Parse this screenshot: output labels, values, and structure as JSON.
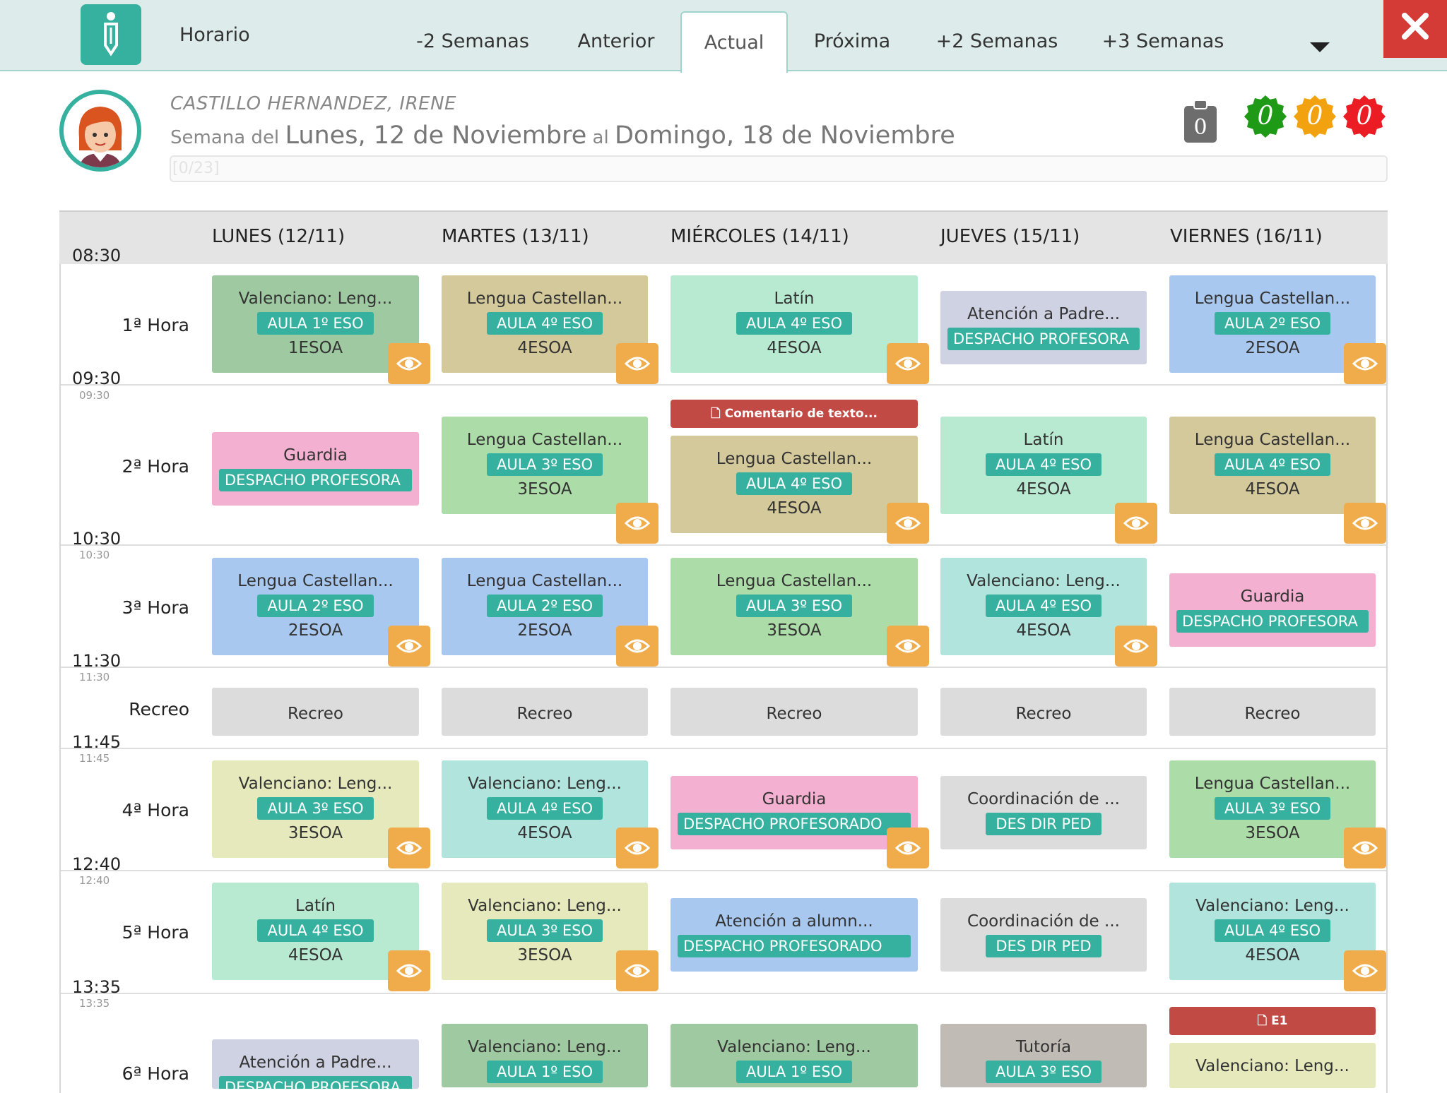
{
  "app": {
    "title": "Horario"
  },
  "tabs": [
    "-2 Semanas",
    "Anterior",
    "Actual",
    "Próxima",
    "+2 Semanas",
    "+3 Semanas"
  ],
  "header": {
    "teacher": "CASTILLO HERNANDEZ, IRENE",
    "week_prefix": "Semana del",
    "week_from": "Lunes, 12 de Noviembre",
    "week_mid": "al",
    "week_to": "Domingo, 18 de Noviembre",
    "progress_text": "[0/23]",
    "clipboard_count": "0",
    "counters": [
      {
        "value": "0",
        "color": "#1e9a16"
      },
      {
        "value": "0",
        "color": "#f2a20f"
      },
      {
        "value": "0",
        "color": "#ec1c24"
      }
    ]
  },
  "days": [
    "LUNES (12/11)",
    "MARTES (13/11)",
    "MIÉRCOLES (14/11)",
    "JUEVES (15/11)",
    "VIERNES (16/11)"
  ],
  "times": {
    "t0": "08:30",
    "t1": "09:30",
    "t1s": "09:30",
    "t2": "10:30",
    "t2s": "10:30",
    "t3": "11:30",
    "t3s": "11:30",
    "t4": "11:45",
    "t4s": "11:45",
    "t5": "12:40",
    "t5s": "12:40",
    "t6": "13:35",
    "t6s": "13:35"
  },
  "periods": [
    "1ª Hora",
    "2ª Hora",
    "3ª Hora",
    "Recreo",
    "4ª Hora",
    "5ª Hora",
    "6ª Hora"
  ],
  "cells": {
    "r1": [
      {
        "subject": "Valenciano: Leng...",
        "room": "AULA 1º ESO",
        "group": "1ESOA"
      },
      {
        "subject": "Lengua Castellan...",
        "room": "AULA 4º ESO",
        "group": "4ESOA"
      },
      {
        "subject": "Latín",
        "room": "AULA 4º ESO",
        "group": "4ESOA"
      },
      {
        "subject": "Atención a Padre...",
        "room": "DESPACHO PROFESORA"
      },
      {
        "subject": "Lengua Castellan...",
        "room": "AULA 2º ESO",
        "group": "2ESOA"
      }
    ],
    "r2": [
      {
        "subject": "Guardia",
        "room": "DESPACHO PROFESORA"
      },
      {
        "subject": "Lengua Castellan...",
        "room": "AULA 3º ESO",
        "group": "3ESOA"
      },
      {
        "subject": "Lengua Castellan...",
        "room": "AULA 4º ESO",
        "group": "4ESOA",
        "note": "Comentario de texto..."
      },
      {
        "subject": "Latín",
        "room": "AULA 4º ESO",
        "group": "4ESOA"
      },
      {
        "subject": "Lengua Castellan...",
        "room": "AULA 4º ESO",
        "group": "4ESOA"
      }
    ],
    "r3": [
      {
        "subject": "Lengua Castellan...",
        "room": "AULA 2º ESO",
        "group": "2ESOA"
      },
      {
        "subject": "Lengua Castellan...",
        "room": "AULA 2º ESO",
        "group": "2ESOA"
      },
      {
        "subject": "Lengua Castellan...",
        "room": "AULA 3º ESO",
        "group": "3ESOA"
      },
      {
        "subject": "Valenciano: Leng...",
        "room": "AULA 4º ESO",
        "group": "4ESOA"
      },
      {
        "subject": "Guardia",
        "room": "DESPACHO PROFESORA"
      }
    ],
    "recreo": [
      "Recreo",
      "Recreo",
      "Recreo",
      "Recreo",
      "Recreo"
    ],
    "r4": [
      {
        "subject": "Valenciano: Leng...",
        "room": "AULA 3º ESO",
        "group": "3ESOA"
      },
      {
        "subject": "Valenciano: Leng...",
        "room": "AULA 4º ESO",
        "group": "4ESOA"
      },
      {
        "subject": "Guardia",
        "room": "DESPACHO PROFESORADO"
      },
      {
        "subject": "Coordinación de ...",
        "room": "DES DIR PED"
      },
      {
        "subject": "Lengua Castellan...",
        "room": "AULA 3º ESO",
        "group": "3ESOA"
      }
    ],
    "r5": [
      {
        "subject": "Latín",
        "room": "AULA 4º ESO",
        "group": "4ESOA"
      },
      {
        "subject": "Valenciano: Leng...",
        "room": "AULA 3º ESO",
        "group": "3ESOA"
      },
      {
        "subject": "Atención a alumn...",
        "room": "DESPACHO PROFESORADO"
      },
      {
        "subject": "Coordinación de ...",
        "room": "DES DIR PED"
      },
      {
        "subject": "Valenciano: Leng...",
        "room": "AULA 4º ESO",
        "group": "4ESOA"
      }
    ],
    "r6": [
      {
        "subject": "Atención a Padre...",
        "room": "DESPACHO PROFESORA"
      },
      {
        "subject": "Valenciano: Leng...",
        "room": "AULA 1º ESO"
      },
      {
        "subject": "Valenciano: Leng...",
        "room": "AULA 1º ESO"
      },
      {
        "subject": "Tutoría",
        "room": "AULA 3º ESO"
      },
      {
        "subject": "Valenciano: Leng...",
        "note": "E1"
      }
    ]
  },
  "colors": {
    "green_dark": "#9fc9a0",
    "tan": "#d3c99b",
    "mint": "#b8ead2",
    "lavender": "#cfd2e2",
    "blue": "#a9c8f0",
    "pink": "#f4b0d1",
    "green": "#acdca7",
    "teal_light": "#b0e4dc",
    "yellow_light": "#e5e9bc",
    "grey": "#dcdcdc",
    "grey_tutoria": "#c1bbb5",
    "accent": "#36b19f",
    "eye": "#f0ac4b",
    "note": "#c24a44"
  }
}
